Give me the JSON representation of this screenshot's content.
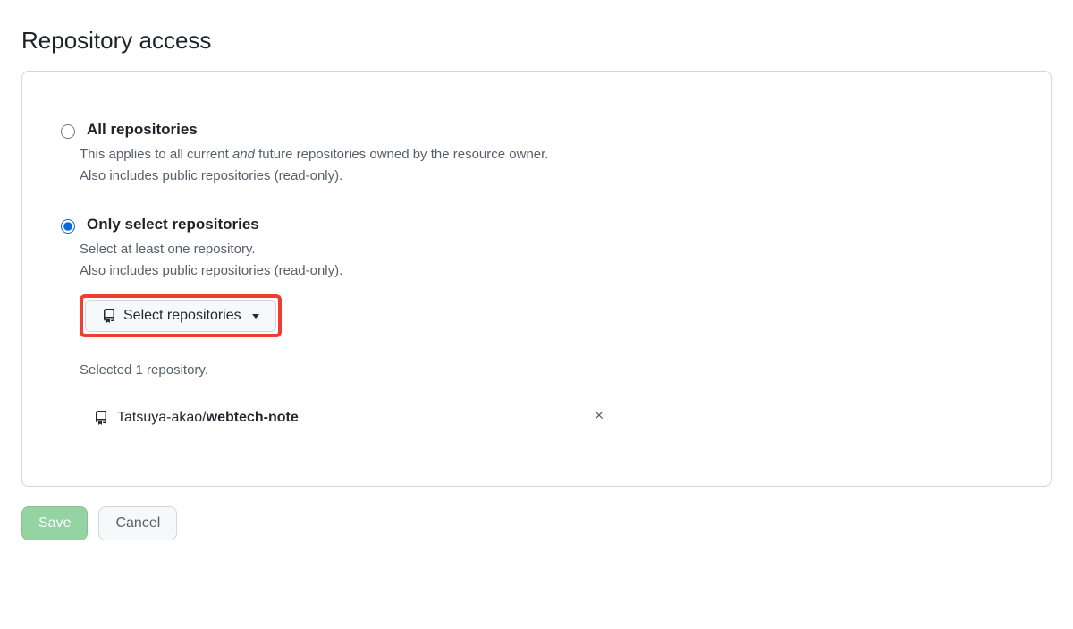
{
  "title": "Repository access",
  "options": {
    "all": {
      "label": "All repositories",
      "desc_prefix": "This applies to all current ",
      "desc_em": "and",
      "desc_suffix": " future repositories owned by the resource owner.",
      "desc_line2": "Also includes public repositories (read-only).",
      "selected": false
    },
    "select": {
      "label": "Only select repositories",
      "desc_line1": "Select at least one repository.",
      "desc_line2": "Also includes public repositories (read-only).",
      "selected": true
    }
  },
  "select_button": "Select repositories",
  "selected_text": "Selected 1 repository.",
  "selected_repo": {
    "owner": "Tatsuya-akao",
    "slash": "/",
    "name": "webtech-note"
  },
  "buttons": {
    "save": "Save",
    "cancel": "Cancel"
  },
  "highlight_color": "#ef3e2f"
}
